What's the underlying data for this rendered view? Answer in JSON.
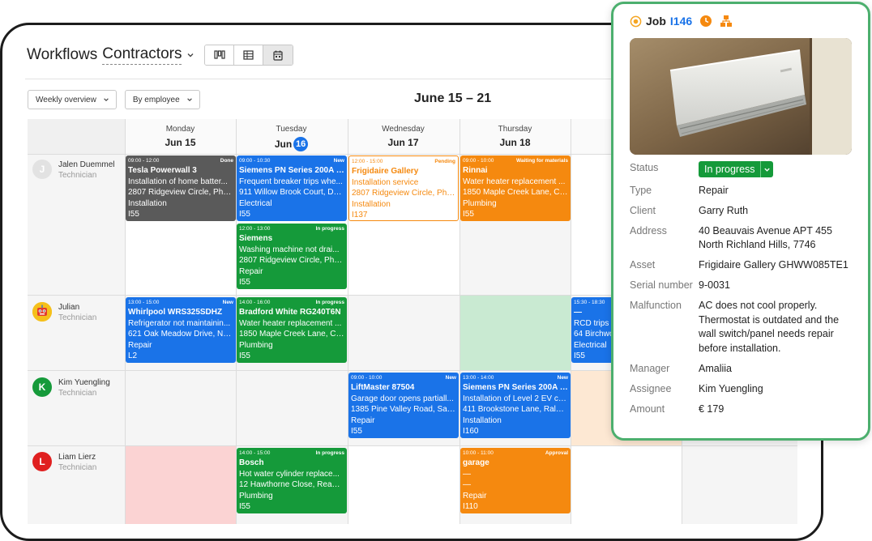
{
  "header": {
    "title": "Workflows",
    "subtitle": "Contractors"
  },
  "filters": {
    "overview": "Weekly overview",
    "grouping": "By employee"
  },
  "date_range": "June 15 – 21",
  "days": [
    {
      "name": "Monday",
      "date": "Jun 15"
    },
    {
      "name": "Tuesday",
      "date": "Jun",
      "badge": "16"
    },
    {
      "name": "Wednesday",
      "date": "Jun 17"
    },
    {
      "name": "Thursday",
      "date": "Jun 18"
    },
    {
      "name": "",
      "date": "J"
    }
  ],
  "employees": [
    {
      "name": "Jalen Duemmel",
      "role": "Technician",
      "initial": "J"
    },
    {
      "name": "Julian",
      "role": "Technician",
      "initial": ""
    },
    {
      "name": "Kim Yuengling",
      "role": "Technician",
      "initial": "K"
    },
    {
      "name": "Liam Lierz",
      "role": "Technician",
      "initial": "L"
    }
  ],
  "jobs": [
    {
      "time": "09:00 - 12:00",
      "status": "Done",
      "title": "Tesla Powerwall 3",
      "l1": "Installation of home batter...",
      "l2": "2807 Ridgeview Circle, Pho...",
      "l3": "Installation",
      "l4": "I55"
    },
    {
      "time": "09:00 - 10:30",
      "status": "New",
      "title": "Siemens PN Series 200A L...",
      "l1": "Frequent breaker trips whe...",
      "l2": "911 Willow Brook Court, De...",
      "l3": "Electrical",
      "l4": "I55"
    },
    {
      "time": "12:00 - 15:00",
      "status": "Pending",
      "title": "Frigidaire Gallery",
      "l1": "Installation service",
      "l2": "2807 Ridgeview Circle, Pho...",
      "l3": "Installation",
      "l4": "I137"
    },
    {
      "time": "09:00 - 10:00",
      "status": "Waiting for materials",
      "title": "Rinnai",
      "l1": "Water heater replacement ...",
      "l2": "1850 Maple Creek Lane, Ch...",
      "l3": "Plumbing",
      "l4": "I55"
    },
    {
      "time": "12:00 - 13:00",
      "status": "In progress",
      "title": "Siemens",
      "l1": "Washing machine not drai...",
      "l2": "2807 Ridgeview Circle, Pho...",
      "l3": "Repair",
      "l4": "I55"
    },
    {
      "time": "13:00 - 15:00",
      "status": "New",
      "title": "Whirlpool WRS325SDHZ",
      "l1": "Refrigerator not maintainin...",
      "l2": "621 Oak Meadow Drive, Na...",
      "l3": "Repair",
      "l4": "L2"
    },
    {
      "time": "14:00 - 16:00",
      "status": "In progress",
      "title": "Bradford White RG240T6N",
      "l1": "Water heater replacement ...",
      "l2": "1850 Maple Creek Lane, Ch...",
      "l3": "Plumbing",
      "l4": "I55"
    },
    {
      "time": "15:30 - 18:30",
      "status": "",
      "title": "—",
      "l1": "RCD trips in",
      "l2": "64 Birchwo",
      "l3": "Electrical",
      "l4": "I55"
    },
    {
      "time": "09:00 - 10:00",
      "status": "New",
      "title": "LiftMaster 87504",
      "l1": "Garage door opens partiall...",
      "l2": "1385 Pine Valley Road, Sacr...",
      "l3": "Repair",
      "l4": "I55"
    },
    {
      "time": "13:00 - 14:00",
      "status": "New",
      "title": "Siemens PN Series 200A L...",
      "l1": "Installation of Level 2 EV ch...",
      "l2": "411 Brookstone Lane, Ralei...",
      "l3": "Installation",
      "l4": "I160"
    },
    {
      "time": "14:00 - 15:00",
      "status": "In progress",
      "title": "Bosch",
      "l1": "Hot water cylinder replace...",
      "l2": "12 Hawthorne Close, Readi...",
      "l3": "Plumbing",
      "l4": "I55"
    },
    {
      "time": "10:00 - 11:00",
      "status": "Approval",
      "title": "garage",
      "l1": "—",
      "l2": "—",
      "l3": "Repair",
      "l4": "I110"
    }
  ],
  "panel": {
    "job_label": "Job",
    "job_id": "I146",
    "fields": [
      {
        "k": "Type",
        "v": "Repair"
      },
      {
        "k": "Client",
        "v": "Garry Ruth"
      },
      {
        "k": "Address",
        "v": "40 Beauvais Avenue APT 455 North Richland Hills, 7746"
      },
      {
        "k": "Asset",
        "v": "Frigidaire Gallery GHWW085TE1"
      },
      {
        "k": "Serial number",
        "v": "9-0031"
      },
      {
        "k": "Malfunction",
        "v": "AC does not cool properly. Thermostat is outdated and the wall switch/panel needs repair before installation."
      },
      {
        "k": "Manager",
        "v": "Amaliia"
      },
      {
        "k": "Assignee",
        "v": "Kim Yuengling"
      },
      {
        "k": "Amount",
        "v": "€ 179"
      }
    ],
    "status_label": "Status",
    "status_value": "In progress"
  },
  "colors": {
    "blue": "#1a73e8",
    "green": "#159a3a",
    "orange": "#f5890f",
    "gray": "#5a5a5a",
    "panel_border": "#4caf6e"
  }
}
